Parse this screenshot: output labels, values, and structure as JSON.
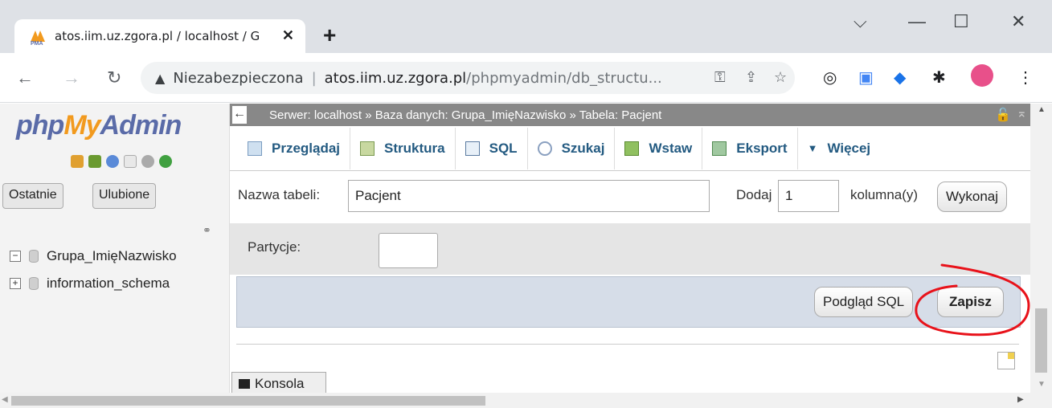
{
  "browser": {
    "tab_title": "atos.iim.uz.zgora.pl / localhost / G",
    "tab_close": "✕",
    "new_tab": "+",
    "url_security": "Niezabezpieczona",
    "url_host": "atos.iim.uz.zgora.pl",
    "url_path": "/phpmyadmin/db_structu...",
    "window_controls": {
      "dropdown": "⌵",
      "minimize": "—",
      "maximize": "☐",
      "close": "✕"
    }
  },
  "sidebar": {
    "logo_php": "php",
    "logo_my": "My",
    "logo_admin": "Admin",
    "recent_label": "Ostatnie",
    "favorites_label": "Ulubione",
    "tree": [
      {
        "name": "Grupa_ImięNazwisko",
        "expander": "−"
      },
      {
        "name": "information_schema",
        "expander": "+"
      }
    ]
  },
  "breadcrumb": {
    "server": "Serwer: localhost »",
    "database": "Baza danych: Grupa_ImięNazwisko »",
    "table": "Tabela: Pacjent"
  },
  "tabs": [
    {
      "label": "Przeglądaj",
      "icon": "browse-icon"
    },
    {
      "label": "Struktura",
      "icon": "structure-icon"
    },
    {
      "label": "SQL",
      "icon": "sql-icon"
    },
    {
      "label": "Szukaj",
      "icon": "search-icon"
    },
    {
      "label": "Wstaw",
      "icon": "insert-icon"
    },
    {
      "label": "Eksport",
      "icon": "export-icon"
    },
    {
      "label": "Więcej",
      "icon": "caret-down-icon"
    }
  ],
  "form": {
    "table_name_label": "Nazwa tabeli:",
    "table_name_value": "Pacjent",
    "add_label": "Dodaj",
    "add_value": "1",
    "columns_label": "kolumna(y)",
    "execute_button": "Wykonaj",
    "partitions_label": "Partycje:",
    "preview_sql_button": "Podgląd SQL",
    "save_button": "Zapisz"
  },
  "console_label": "Konsola",
  "colors": {
    "annotation": "#e8121a",
    "tab_text": "#235a81",
    "topbar": "#888888"
  }
}
